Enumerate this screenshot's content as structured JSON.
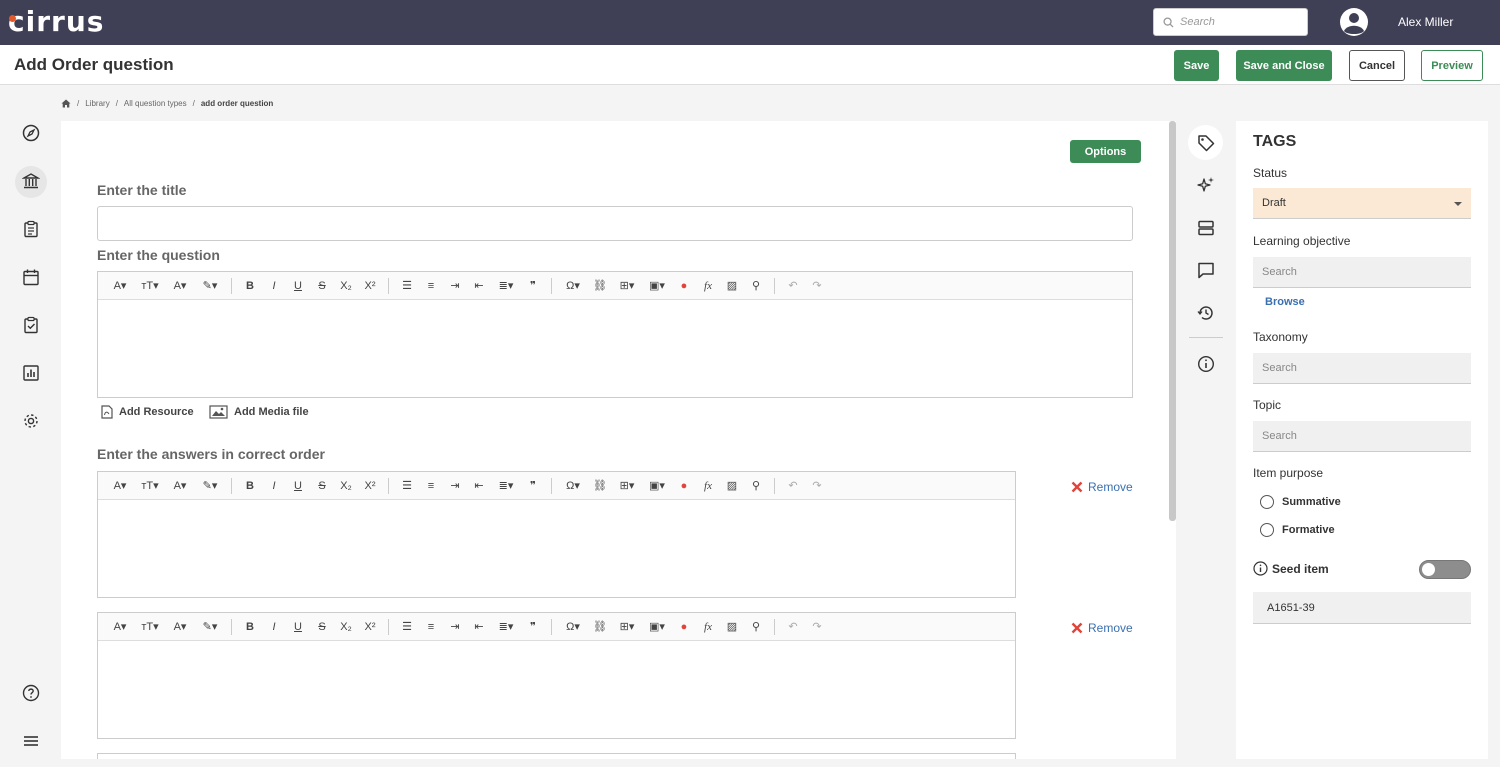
{
  "app": {
    "logo": "cirrus",
    "search_placeholder": "Search",
    "user_name": "Alex Miller"
  },
  "header": {
    "title": "Add Order question",
    "save_label": "Save",
    "save_close_label": "Save and Close",
    "cancel_label": "Cancel",
    "preview_label": "Preview"
  },
  "breadcrumb": {
    "items": [
      "Library",
      "All question types"
    ],
    "current": "add order question"
  },
  "main": {
    "options_label": "Options",
    "title_label": "Enter the title",
    "question_label": "Enter the question",
    "add_resource_label": "Add Resource",
    "add_media_label": "Add Media file",
    "answers_label": "Enter the answers in correct order",
    "remove_label": "Remove"
  },
  "tags": {
    "title": "TAGS",
    "status_label": "Status",
    "status_value": "Draft",
    "learning_objective_label": "Learning objective",
    "search_placeholder": "Search",
    "browse_label": "Browse",
    "taxonomy_label": "Taxonomy",
    "topic_label": "Topic",
    "item_purpose_label": "Item purpose",
    "purpose_options": [
      "Summative",
      "Formative"
    ],
    "seed_item_label": "Seed item",
    "seed_item_value": "A1651-39"
  },
  "colors": {
    "topbar": "#3f3f55",
    "primary": "#3d8b57",
    "link": "#3a6fb0",
    "status_bg": "#fbe9d5",
    "remove_icon": "#e0443a"
  }
}
